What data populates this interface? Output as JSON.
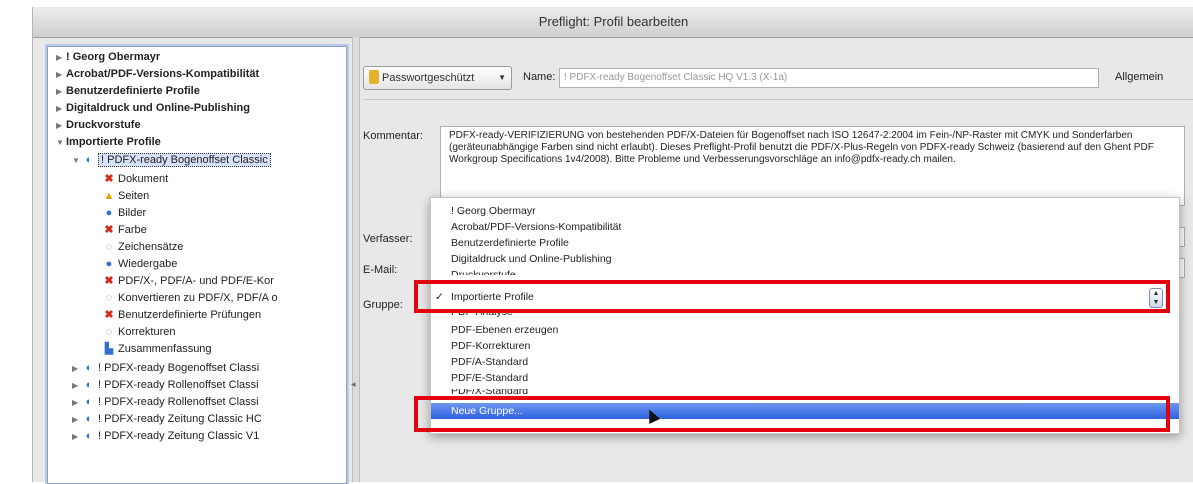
{
  "window": {
    "title": "Preflight: Profil bearbeiten"
  },
  "tree": {
    "groups": [
      {
        "label": "! Georg Obermayr",
        "expanded": false
      },
      {
        "label": "Acrobat/PDF-Versions-Kompatibilität",
        "expanded": false
      },
      {
        "label": "Benutzerdefinierte Profile",
        "expanded": false
      },
      {
        "label": "Digitaldruck und Online-Publishing",
        "expanded": false
      },
      {
        "label": "Druckvorstufe",
        "expanded": false
      },
      {
        "label": "Importierte Profile",
        "expanded": true
      }
    ],
    "selected_profile": "! PDFX-ready Bogenoffset Classic",
    "sub_items": [
      {
        "label": "Dokument",
        "icon": "error-x-icon"
      },
      {
        "label": "Seiten",
        "icon": "warning-icon"
      },
      {
        "label": "Bilder",
        "icon": "info-icon"
      },
      {
        "label": "Farbe",
        "icon": "error-x-icon"
      },
      {
        "label": "Zeichensätze",
        "icon": "neutral-icon"
      },
      {
        "label": "Wiedergabe",
        "icon": "info-icon"
      },
      {
        "label": "PDF/X-, PDF/A- und PDF/E-Kor",
        "icon": "error-x-icon"
      },
      {
        "label": "Konvertieren zu PDF/X, PDF/A o",
        "icon": "neutral-icon"
      },
      {
        "label": "Benutzerdefinierte Prüfungen",
        "icon": "error-x-icon"
      },
      {
        "label": "Korrekturen",
        "icon": "neutral-icon"
      },
      {
        "label": "Zusammenfassung",
        "icon": "summary-icon"
      }
    ],
    "other_profiles": [
      "! PDFX-ready Bogenoffset Classi",
      "! PDFX-ready Rollenoffset Classi",
      "! PDFX-ready Rollenoffset Classi",
      "! PDFX-ready Zeitung Classic HC",
      "! PDFX-ready Zeitung Classic V1"
    ]
  },
  "form": {
    "lock_button": "Passwortgeschützt",
    "name_label": "Name:",
    "name_value": "! PDFX-ready Bogenoffset Classic HQ V1.3 (X-1a)",
    "general_label": "Allgemein",
    "comment_label": "Kommentar:",
    "comment_text": "PDFX-ready-VERIFIZIERUNG von bestehenden PDF/X-Dateien für Bogenoffset nach ISO 12647-2:2004 im Fein-/NP-Raster mit CMYK und Sonderfarben (geräteunabhängige Farben sind nicht erlaubt). Dieses Preflight-Profil benutzt die PDF/X-Plus-Regeln von PDFX-ready Schweiz (basierend auf den Ghent PDF Workgroup Specifications 1v4/2008). Bitte Probleme und Verbesserungsvorschläge an info@pdfx-ready.ch mailen.",
    "author_label": "Verfasser:",
    "email_label": "E-Mail:",
    "group_label": "Gruppe:"
  },
  "group_menu": {
    "items": [
      "! Georg Obermayr",
      "Acrobat/PDF-Versions-Kompatibilität",
      "Benutzerdefinierte Profile",
      "Digitaldruck und Online-Publishing",
      "Druckvorstufe",
      "Importierte Profile",
      "PDF-Analyse",
      "PDF-Ebenen erzeugen",
      "PDF-Korrekturen",
      "PDF/A-Standard",
      "PDF/E-Standard",
      "PDF/X-Standard",
      "Neue Gruppe..."
    ],
    "checked_item": "Importierte Profile",
    "highlighted_item": "Neue Gruppe..."
  },
  "colors": {
    "highlight": "#2f62e0",
    "annotation_red": "#e3000f",
    "error_icon": "#d12a1e",
    "warning_icon": "#e4a300",
    "info_icon": "#2f6fcf"
  }
}
